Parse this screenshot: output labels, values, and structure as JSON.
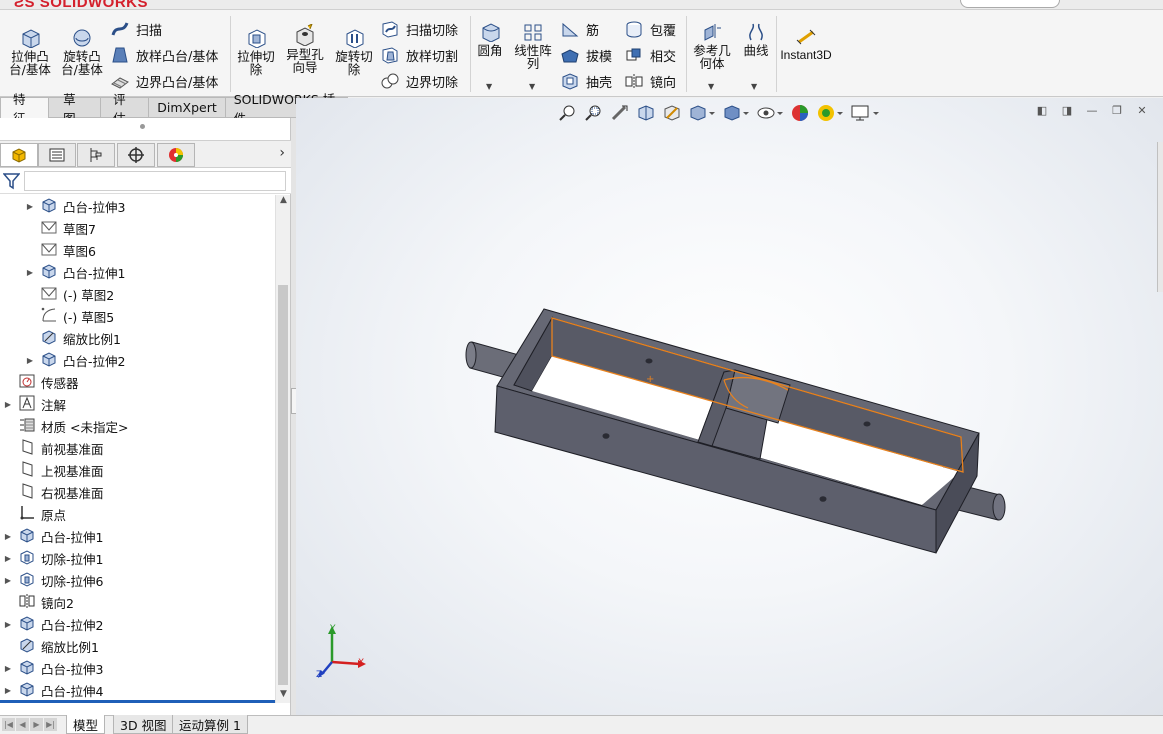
{
  "app": {
    "logo_text": "SOLIDWORKS"
  },
  "ribbon": {
    "extrude_boss": "拉伸凸\n台/基体",
    "revolve_boss": "旋转凸\n台/基体",
    "sweep": "扫描",
    "loft_boss": "放样凸台/基体",
    "boundary_boss": "边界凸台/基体",
    "extrude_cut": "拉伸切\n除",
    "hole_wizard": "异型孔\n向导",
    "revolve_cut": "旋转切\n除",
    "sweep_cut": "扫描切除",
    "loft_cut": "放样切割",
    "boundary_cut": "边界切除",
    "fillet": "圆角",
    "linear_pattern": "线性阵\n列",
    "rib": "筋",
    "draft": "拔模",
    "shell": "抽壳",
    "wrap": "包覆",
    "intersect": "相交",
    "mirror": "镜向",
    "ref_geometry": "参考几\n何体",
    "curves": "曲线",
    "instant3d": "Instant3D"
  },
  "tabs": [
    "特征",
    "草图",
    "评估",
    "DimXpert",
    "SOLIDWORKS 插件"
  ],
  "tree": [
    {
      "label": "凸台-拉伸3",
      "icon": "extrude-icon",
      "expand": true,
      "indent": 1
    },
    {
      "label": "草图7",
      "icon": "sketch-icon",
      "expand": false,
      "indent": 1
    },
    {
      "label": "草图6",
      "icon": "sketch-icon",
      "expand": false,
      "indent": 1
    },
    {
      "label": "凸台-拉伸1",
      "icon": "extrude-icon",
      "expand": true,
      "indent": 1
    },
    {
      "label": "(-) 草图2",
      "icon": "sketch-icon",
      "expand": false,
      "indent": 1
    },
    {
      "label": "(-) 草图5",
      "icon": "sketch-arc-icon",
      "expand": false,
      "indent": 1
    },
    {
      "label": "缩放比例1",
      "icon": "scale-icon",
      "expand": false,
      "indent": 1
    },
    {
      "label": "凸台-拉伸2",
      "icon": "extrude-icon",
      "expand": true,
      "indent": 1
    },
    {
      "label": "传感器",
      "icon": "sensor-icon",
      "expand": false,
      "indent": 0
    },
    {
      "label": "注解",
      "icon": "annotation-icon",
      "expand": true,
      "indent": 0
    },
    {
      "label": "材质 <未指定>",
      "icon": "material-icon",
      "expand": false,
      "indent": 0
    },
    {
      "label": "前视基准面",
      "icon": "plane-icon",
      "expand": false,
      "indent": 0
    },
    {
      "label": "上视基准面",
      "icon": "plane-icon",
      "expand": false,
      "indent": 0
    },
    {
      "label": "右视基准面",
      "icon": "plane-icon",
      "expand": false,
      "indent": 0
    },
    {
      "label": "原点",
      "icon": "origin-icon",
      "expand": false,
      "indent": 0
    },
    {
      "label": "凸台-拉伸1",
      "icon": "extrude-icon",
      "expand": true,
      "indent": 0
    },
    {
      "label": "切除-拉伸1",
      "icon": "cut-icon",
      "expand": true,
      "indent": 0
    },
    {
      "label": "切除-拉伸6",
      "icon": "cut-icon",
      "expand": true,
      "indent": 0
    },
    {
      "label": "镜向2",
      "icon": "mirror-icon",
      "expand": false,
      "indent": 0
    },
    {
      "label": "凸台-拉伸2",
      "icon": "extrude-icon",
      "expand": true,
      "indent": 0
    },
    {
      "label": "缩放比例1",
      "icon": "scale-icon",
      "expand": false,
      "indent": 0
    },
    {
      "label": "凸台-拉伸3",
      "icon": "extrude-icon",
      "expand": true,
      "indent": 0
    },
    {
      "label": "凸台-拉伸4",
      "icon": "extrude-icon",
      "expand": true,
      "indent": 0
    }
  ],
  "bottom_tabs": [
    "模型",
    "3D 视图",
    "运动算例 1"
  ],
  "triad": {
    "x": "X",
    "y": "Y",
    "z": "Z"
  },
  "colors": {
    "model": "#5d5f6c",
    "selection": "#e8821e",
    "axis_x": "#d42020",
    "axis_y": "#2a9a2a",
    "axis_z": "#2040c0"
  }
}
